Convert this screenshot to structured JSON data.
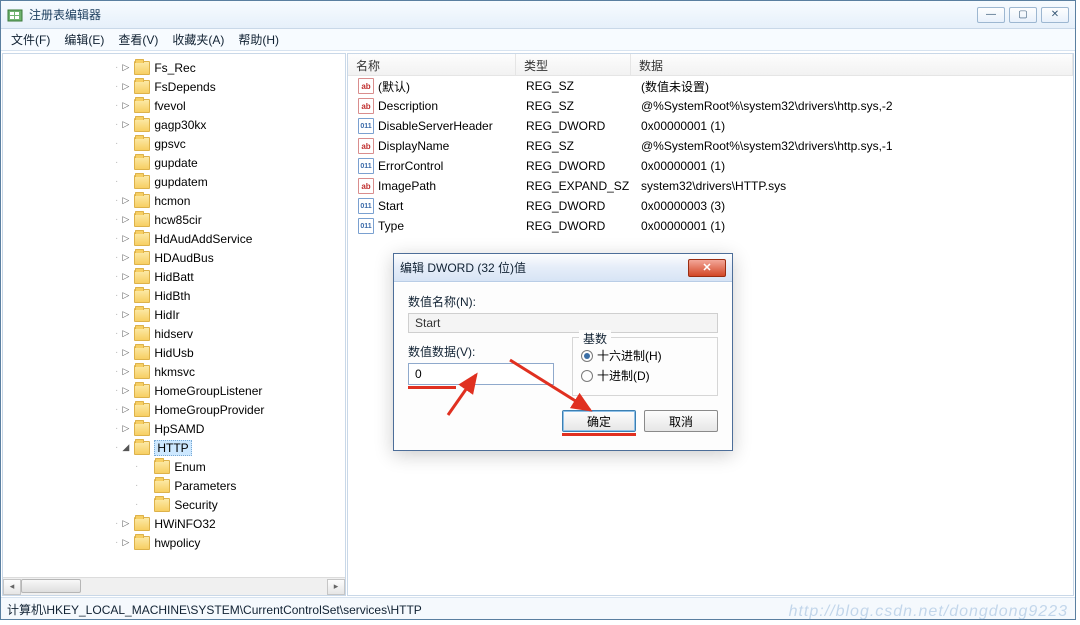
{
  "window": {
    "title": "注册表编辑器"
  },
  "menu": {
    "file": "文件(F)",
    "edit": "编辑(E)",
    "view": "查看(V)",
    "favorites": "收藏夹(A)",
    "help": "帮助(H)"
  },
  "tree_items": [
    {
      "indent": 112,
      "exp": "collapsed",
      "label": "Fs_Rec"
    },
    {
      "indent": 112,
      "exp": "collapsed",
      "label": "FsDepends"
    },
    {
      "indent": 112,
      "exp": "collapsed",
      "label": "fvevol"
    },
    {
      "indent": 112,
      "exp": "collapsed",
      "label": "gagp30kx"
    },
    {
      "indent": 112,
      "exp": "none",
      "label": "gpsvc"
    },
    {
      "indent": 112,
      "exp": "none",
      "label": "gupdate"
    },
    {
      "indent": 112,
      "exp": "none",
      "label": "gupdatem"
    },
    {
      "indent": 112,
      "exp": "collapsed",
      "label": "hcmon"
    },
    {
      "indent": 112,
      "exp": "collapsed",
      "label": "hcw85cir"
    },
    {
      "indent": 112,
      "exp": "collapsed",
      "label": "HdAudAddService"
    },
    {
      "indent": 112,
      "exp": "collapsed",
      "label": "HDAudBus"
    },
    {
      "indent": 112,
      "exp": "collapsed",
      "label": "HidBatt"
    },
    {
      "indent": 112,
      "exp": "collapsed",
      "label": "HidBth"
    },
    {
      "indent": 112,
      "exp": "collapsed",
      "label": "HidIr"
    },
    {
      "indent": 112,
      "exp": "collapsed",
      "label": "hidserv"
    },
    {
      "indent": 112,
      "exp": "collapsed",
      "label": "HidUsb"
    },
    {
      "indent": 112,
      "exp": "collapsed",
      "label": "hkmsvc"
    },
    {
      "indent": 112,
      "exp": "collapsed",
      "label": "HomeGroupListener"
    },
    {
      "indent": 112,
      "exp": "collapsed",
      "label": "HomeGroupProvider"
    },
    {
      "indent": 112,
      "exp": "collapsed",
      "label": "HpSAMD"
    },
    {
      "indent": 112,
      "exp": "expanded",
      "label": "HTTP",
      "sel": true
    },
    {
      "indent": 132,
      "exp": "none",
      "label": "Enum"
    },
    {
      "indent": 132,
      "exp": "none",
      "label": "Parameters"
    },
    {
      "indent": 132,
      "exp": "none",
      "label": "Security"
    },
    {
      "indent": 112,
      "exp": "collapsed",
      "label": "HWiNFO32"
    },
    {
      "indent": 112,
      "exp": "collapsed",
      "label": "hwpolicy"
    }
  ],
  "cols": {
    "name": "名称",
    "type": "类型",
    "data": "数据"
  },
  "rows": [
    {
      "icon": "sz",
      "name": "(默认)",
      "type": "REG_SZ",
      "data": "(数值未设置)"
    },
    {
      "icon": "sz",
      "name": "Description",
      "type": "REG_SZ",
      "data": "@%SystemRoot%\\system32\\drivers\\http.sys,-2"
    },
    {
      "icon": "dw",
      "name": "DisableServerHeader",
      "type": "REG_DWORD",
      "data": "0x00000001 (1)"
    },
    {
      "icon": "sz",
      "name": "DisplayName",
      "type": "REG_SZ",
      "data": "@%SystemRoot%\\system32\\drivers\\http.sys,-1"
    },
    {
      "icon": "dw",
      "name": "ErrorControl",
      "type": "REG_DWORD",
      "data": "0x00000001 (1)"
    },
    {
      "icon": "sz",
      "name": "ImagePath",
      "type": "REG_EXPAND_SZ",
      "data": "system32\\drivers\\HTTP.sys"
    },
    {
      "icon": "dw",
      "name": "Start",
      "type": "REG_DWORD",
      "data": "0x00000003 (3)"
    },
    {
      "icon": "dw",
      "name": "Type",
      "type": "REG_DWORD",
      "data": "0x00000001 (1)"
    }
  ],
  "dlg": {
    "title": "编辑 DWORD (32 位)值",
    "name_label": "数值名称(N):",
    "name_value": "Start",
    "data_label": "数值数据(V):",
    "data_value": "0",
    "base_legend": "基数",
    "hex": "十六进制(H)",
    "dec": "十进制(D)",
    "ok": "确定",
    "cancel": "取消"
  },
  "status": "计算机\\HKEY_LOCAL_MACHINE\\SYSTEM\\CurrentControlSet\\services\\HTTP",
  "watermark": "http://blog.csdn.net/dongdong9223"
}
